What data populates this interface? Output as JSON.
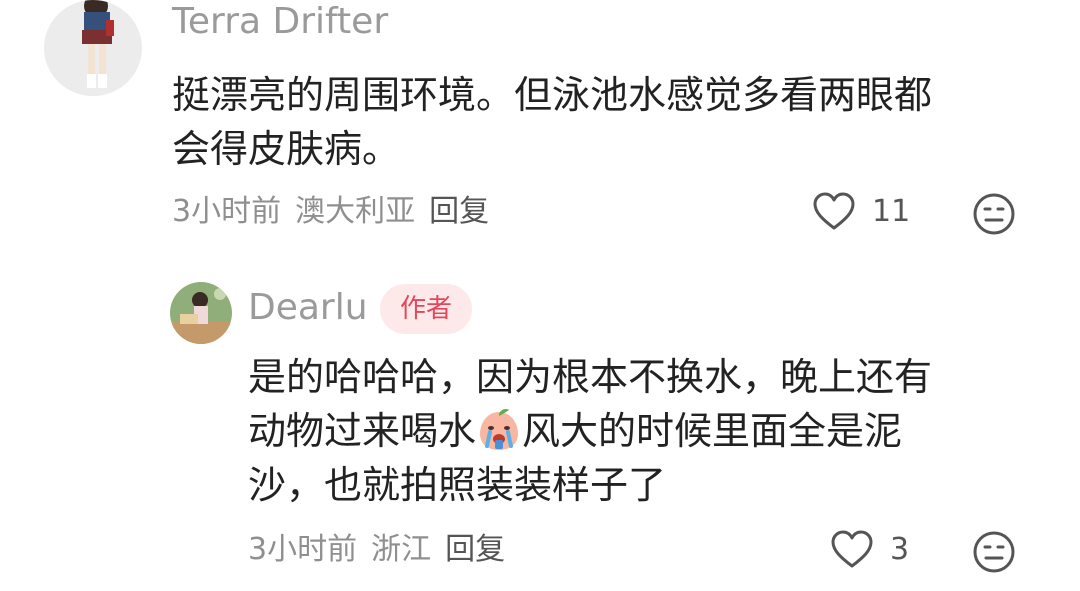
{
  "comments": [
    {
      "username": "Terra Drifter",
      "lines": [
        "挺漂亮的周围环境。但泳池水感觉多看两眼都",
        "会得皮肤病。"
      ],
      "time": "3小时前",
      "location": "澳大利亚",
      "reply_label": "回复",
      "like_count": "11"
    },
    {
      "username": "Dearlu",
      "badge": "作者",
      "lines": [
        "是的哈哈哈，因为根本不换水，晚上还有",
        "动物过来喝水",
        "风大的时候里面全是泥",
        "沙，也就拍照装装样子了"
      ],
      "time": "3小时前",
      "location": "浙江",
      "reply_label": "回复",
      "like_count": "3"
    }
  ],
  "icons": {
    "like": "heart-outline-icon",
    "dislike": "neutral-face-icon",
    "emoji": "crying-peach-emoji"
  },
  "colors": {
    "badge_text": "#e5475a",
    "badge_bg": "#fde9ea",
    "username": "#9a9a9a"
  }
}
